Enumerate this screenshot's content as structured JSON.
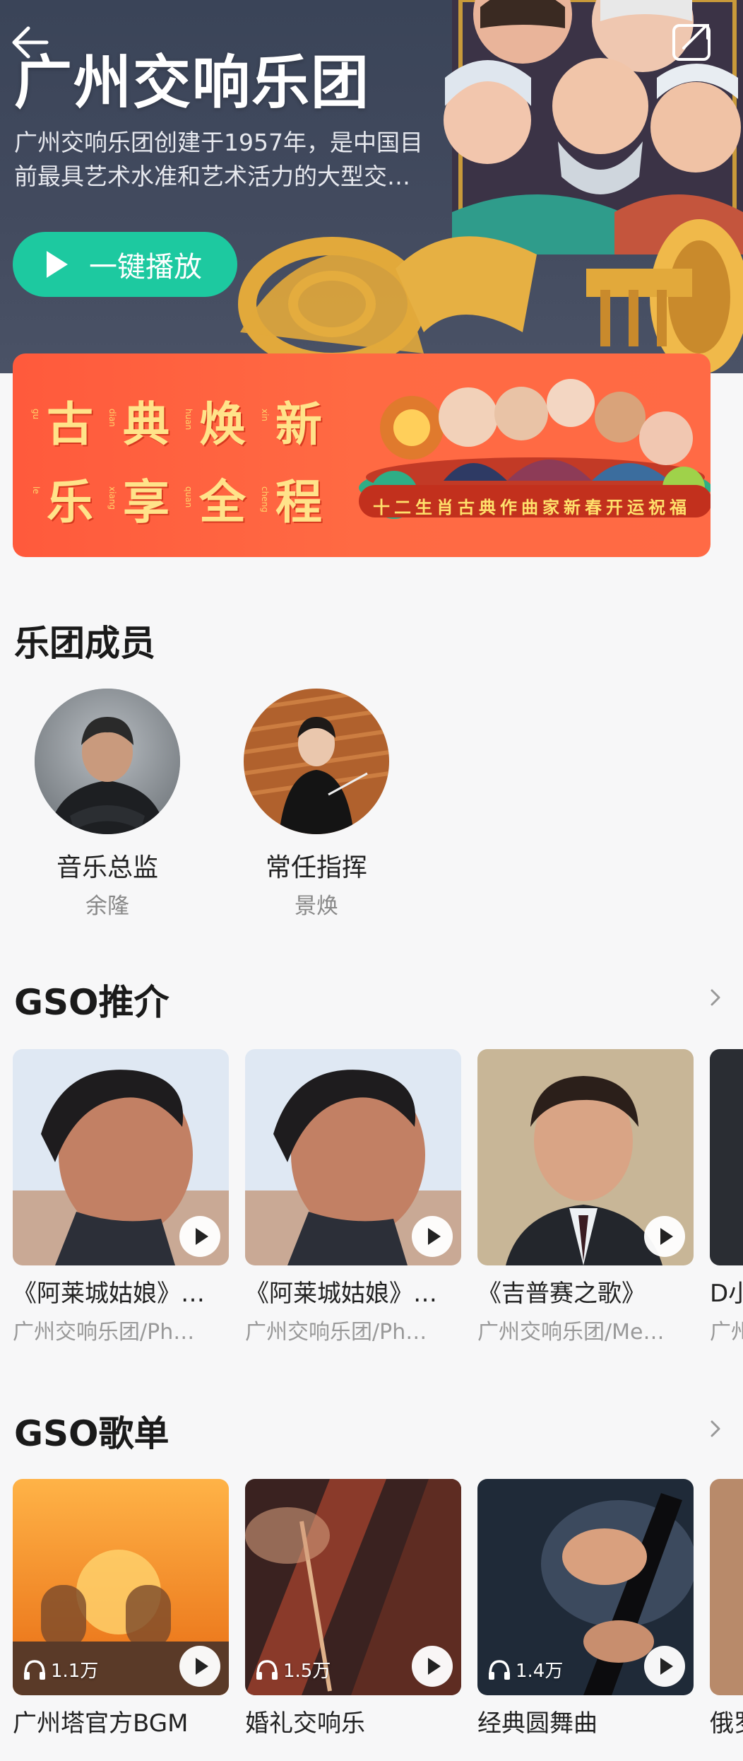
{
  "hero": {
    "title": "广州交响乐团",
    "description": "广州交响乐团创建于1957年，是中国目前最具艺术水准和艺术活力的大型交…",
    "play_all_label": "一键播放"
  },
  "banner": {
    "chars_row1": [
      "古",
      "典",
      "焕",
      "新"
    ],
    "pinyin_row1": [
      "gu",
      "dian",
      "huan",
      "xin"
    ],
    "chars_row2": [
      "乐",
      "享",
      "全",
      "程"
    ],
    "pinyin_row2": [
      "le",
      "xiang",
      "quan",
      "cheng"
    ],
    "caption": "十二生肖古典作曲家新春开运祝福"
  },
  "members": {
    "section_title": "乐团成员",
    "items": [
      {
        "role": "音乐总监",
        "name": "余隆"
      },
      {
        "role": "常任指挥",
        "name": "景焕"
      }
    ]
  },
  "recommend": {
    "section_title": "GSO推介",
    "items": [
      {
        "title": "《阿莱城姑娘》…",
        "subtitle": "广州交响乐团/Ph…"
      },
      {
        "title": "《阿莱城姑娘》…",
        "subtitle": "广州交响乐团/Ph…"
      },
      {
        "title": "《吉普赛之歌》",
        "subtitle": "广州交响乐团/Me…"
      },
      {
        "title": "D小",
        "subtitle": "广州"
      }
    ]
  },
  "playlists": {
    "section_title": "GSO歌单",
    "items": [
      {
        "title": "广州塔官方BGM",
        "plays": "1.1万"
      },
      {
        "title": "婚礼交响乐",
        "plays": "1.5万"
      },
      {
        "title": "经典圆舞曲",
        "plays": "1.4万"
      },
      {
        "title": "俄罗",
        "plays": ""
      }
    ]
  },
  "icons": {
    "back": "back-arrow-icon",
    "share": "share-icon",
    "play": "play-icon",
    "chevron": "chevron-right-icon",
    "headphones": "headphones-icon"
  },
  "colors": {
    "accent": "#1dc9a0",
    "banner": "#ff5a3c",
    "banner_text": "#ffe38a",
    "page_bg": "#f7f7f8"
  }
}
